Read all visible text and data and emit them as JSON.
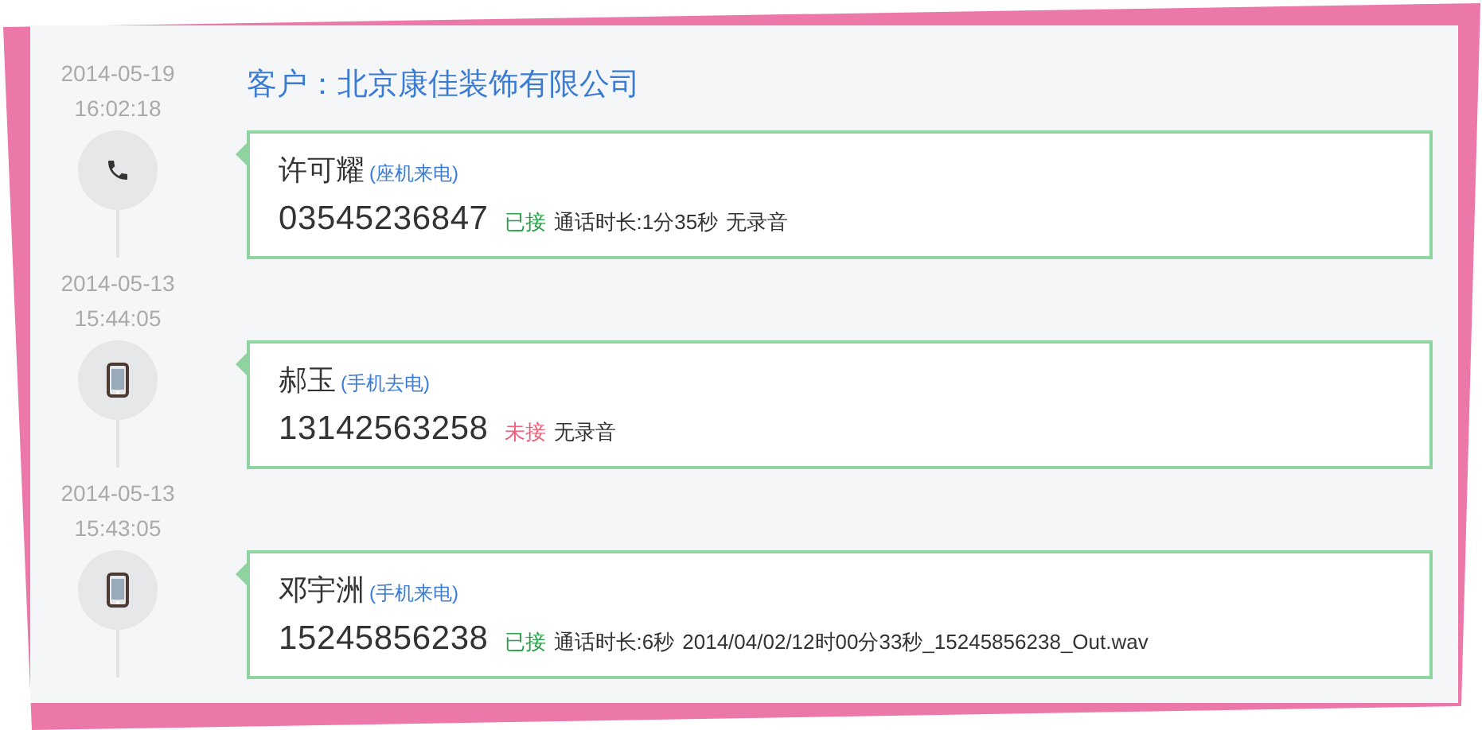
{
  "customer": {
    "label": "客户：",
    "name": "北京康佳装饰有限公司"
  },
  "calls": [
    {
      "date": "2014-05-19",
      "time": "16:02:18",
      "kind": "landline",
      "name": "许可耀",
      "call_type": "(座机来电)",
      "phone": "03545236847",
      "status": "已接",
      "answered": true,
      "details": [
        "通话时长:1分35秒",
        "无录音"
      ]
    },
    {
      "date": "2014-05-13",
      "time": "15:44:05",
      "kind": "mobile",
      "name": "郝玉",
      "call_type": "(手机去电)",
      "phone": "13142563258",
      "status": "未接",
      "answered": false,
      "details": [
        "无录音"
      ]
    },
    {
      "date": "2014-05-13",
      "time": "15:43:05",
      "kind": "mobile",
      "name": "邓宇洲",
      "call_type": "(手机来电)",
      "phone": "15245856238",
      "status": "已接",
      "answered": true,
      "details": [
        "通话时长:6秒",
        "2014/04/02/12时00分33秒_15245856238_Out.wav"
      ]
    }
  ]
}
